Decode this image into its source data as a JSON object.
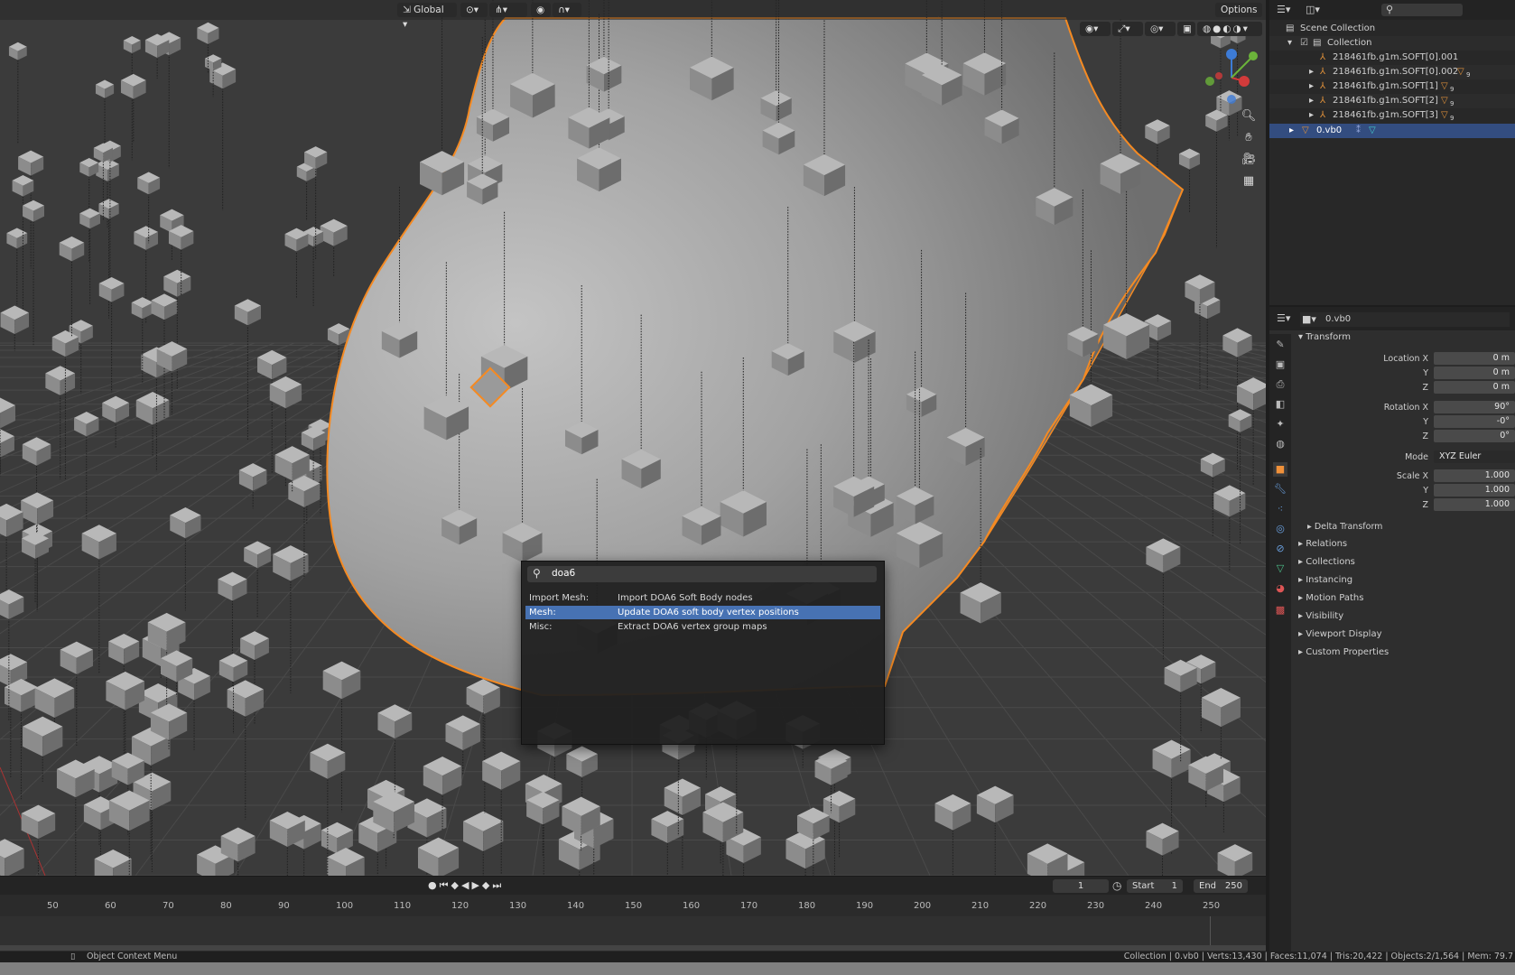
{
  "header": {
    "orientation_label": "Global",
    "options_label": "Options"
  },
  "colors": {
    "selection_outline": "#f58a22",
    "accent_blue": "#4772b3",
    "viewport_bg": "#3d3d3d",
    "mesh_gray": "#9d9d9d"
  },
  "search": {
    "query": "doa6",
    "results": [
      {
        "category": "Import Mesh:",
        "description": "Import DOA6 Soft Body nodes"
      },
      {
        "category": "Mesh:",
        "description": "Update DOA6 soft body vertex positions"
      },
      {
        "category": "Misc:",
        "description": "Extract DOA6 vertex group maps"
      }
    ]
  },
  "outliner": {
    "scene_collection": "Scene Collection",
    "collection": "Collection",
    "items": [
      "218461fb.g1m.SOFT[0].001",
      "218461fb.g1m.SOFT[0].002",
      "218461fb.g1m.SOFT[1]",
      "218461fb.g1m.SOFT[2]",
      "218461fb.g1m.SOFT[3]",
      "0.vb0"
    ],
    "badge": "9"
  },
  "properties": {
    "object_name": "0.vb0",
    "transform_title": "Transform",
    "location_label": "Location X",
    "rotation_label": "Rotation X",
    "scale_label": "Scale X",
    "y_label": "Y",
    "z_label": "Z",
    "mode_label": "Mode",
    "location": [
      "0 m",
      "0 m",
      "0 m"
    ],
    "rotation": [
      "90°",
      "-0°",
      "0°"
    ],
    "mode": "XYZ Euler",
    "scale": [
      "1.000",
      "1.000",
      "1.000"
    ],
    "delta_transform": "Delta Transform",
    "panels": [
      "Relations",
      "Collections",
      "Instancing",
      "Motion Paths",
      "Visibility",
      "Viewport Display",
      "Custom Properties"
    ]
  },
  "timeline": {
    "current_frame": "1",
    "start_label": "Start",
    "start": "1",
    "end_label": "End",
    "end": "250",
    "ticks": [
      "50",
      "60",
      "70",
      "80",
      "90",
      "100",
      "110",
      "120",
      "130",
      "140",
      "150",
      "160",
      "170",
      "180",
      "190",
      "200",
      "210",
      "220",
      "230",
      "240",
      "250"
    ]
  },
  "status": {
    "left": "Object Context Menu",
    "right": "Collection | 0.vb0 | Verts:13,430 | Faces:11,074 | Tris:20,422 | Objects:2/1,564 | Mem: 79.7"
  }
}
